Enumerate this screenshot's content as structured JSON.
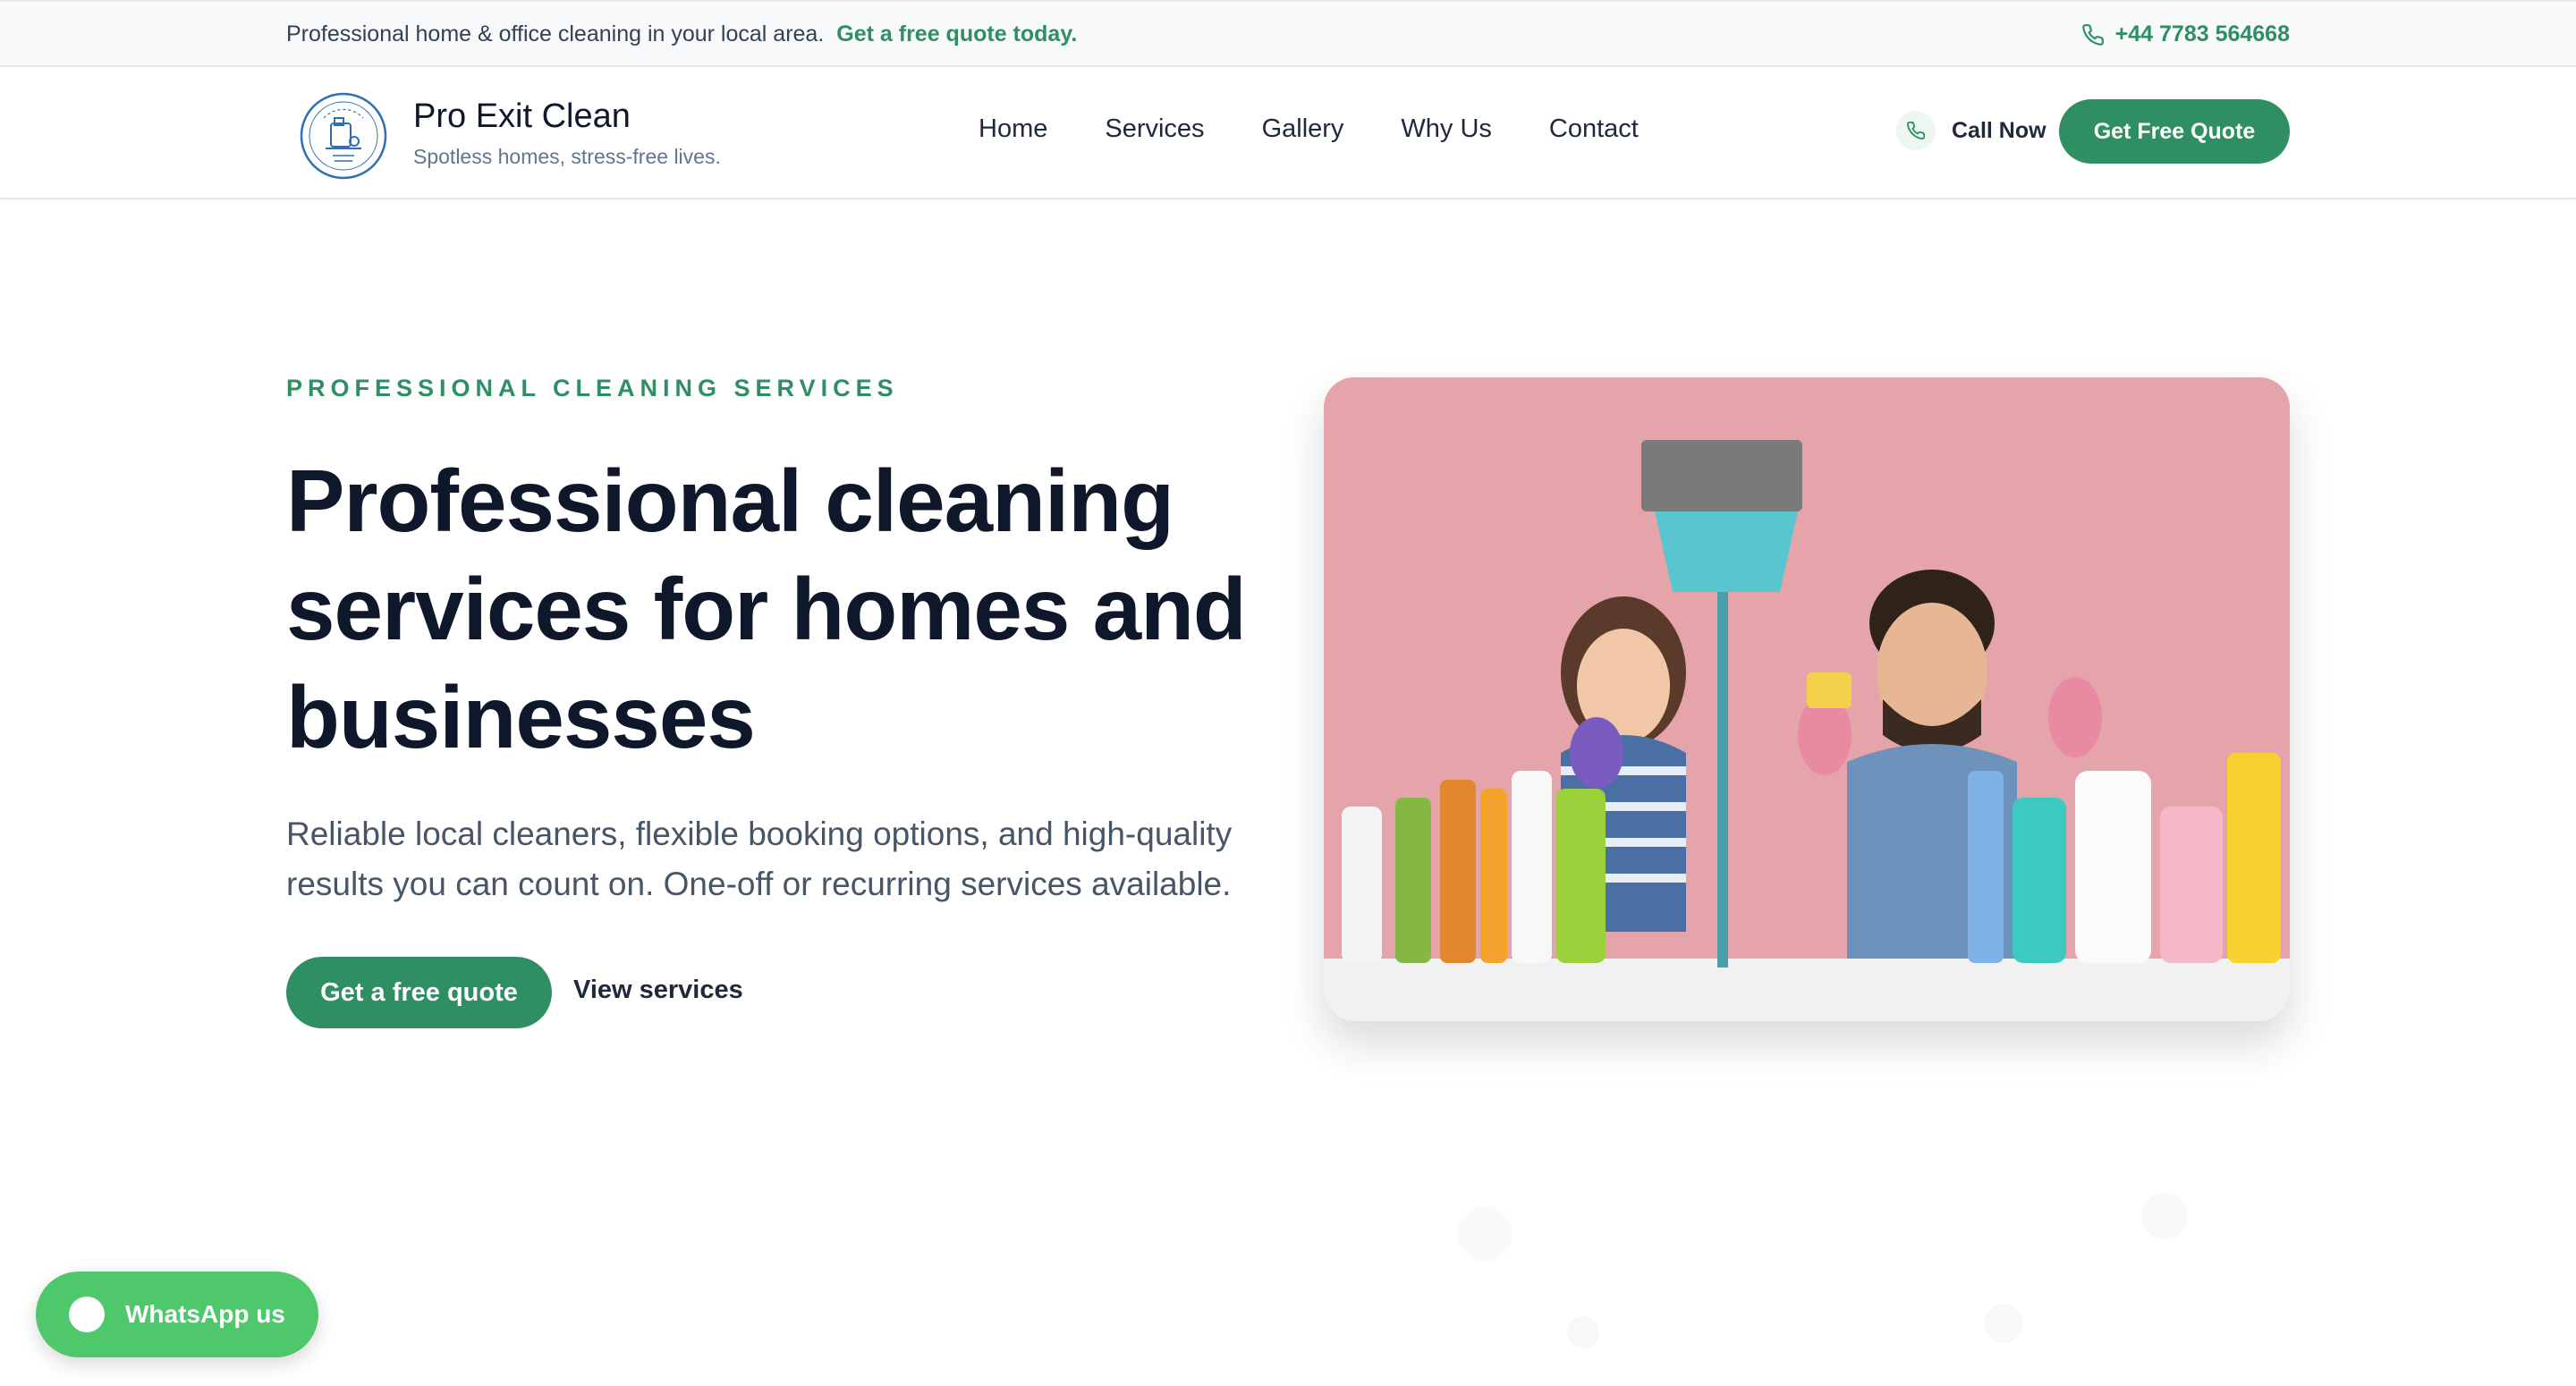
{
  "topbar": {
    "message": "Professional home & office cleaning in your local area.",
    "cta": "Get a free quote today.",
    "phone": "+44 7783 564668"
  },
  "header": {
    "brand_name": "Pro Exit Clean",
    "brand_tagline": "Spotless homes, stress-free lives.",
    "nav": [
      "Home",
      "Services",
      "Gallery",
      "Why Us",
      "Contact"
    ],
    "call_now": "Call Now",
    "quote_button": "Get Free Quote"
  },
  "hero": {
    "eyebrow": "PROFESSIONAL CLEANING SERVICES",
    "headline": "Professional cleaning services for homes and businesses",
    "subtext": "Reliable local cleaners, flexible booking options, and high-quality results you can count on. One-off or recurring services available.",
    "primary_button": "Get a free quote",
    "secondary_link": "View services"
  },
  "floating": {
    "whatsapp": "WhatsApp us"
  },
  "colors": {
    "accent": "#2f8f62",
    "whatsapp": "#4fc76b",
    "hero_image_bg": "#e4a4aa",
    "text_dark": "#0f172a"
  },
  "icons": [
    "phone-icon",
    "logo-icon",
    "whatsapp-icon"
  ]
}
